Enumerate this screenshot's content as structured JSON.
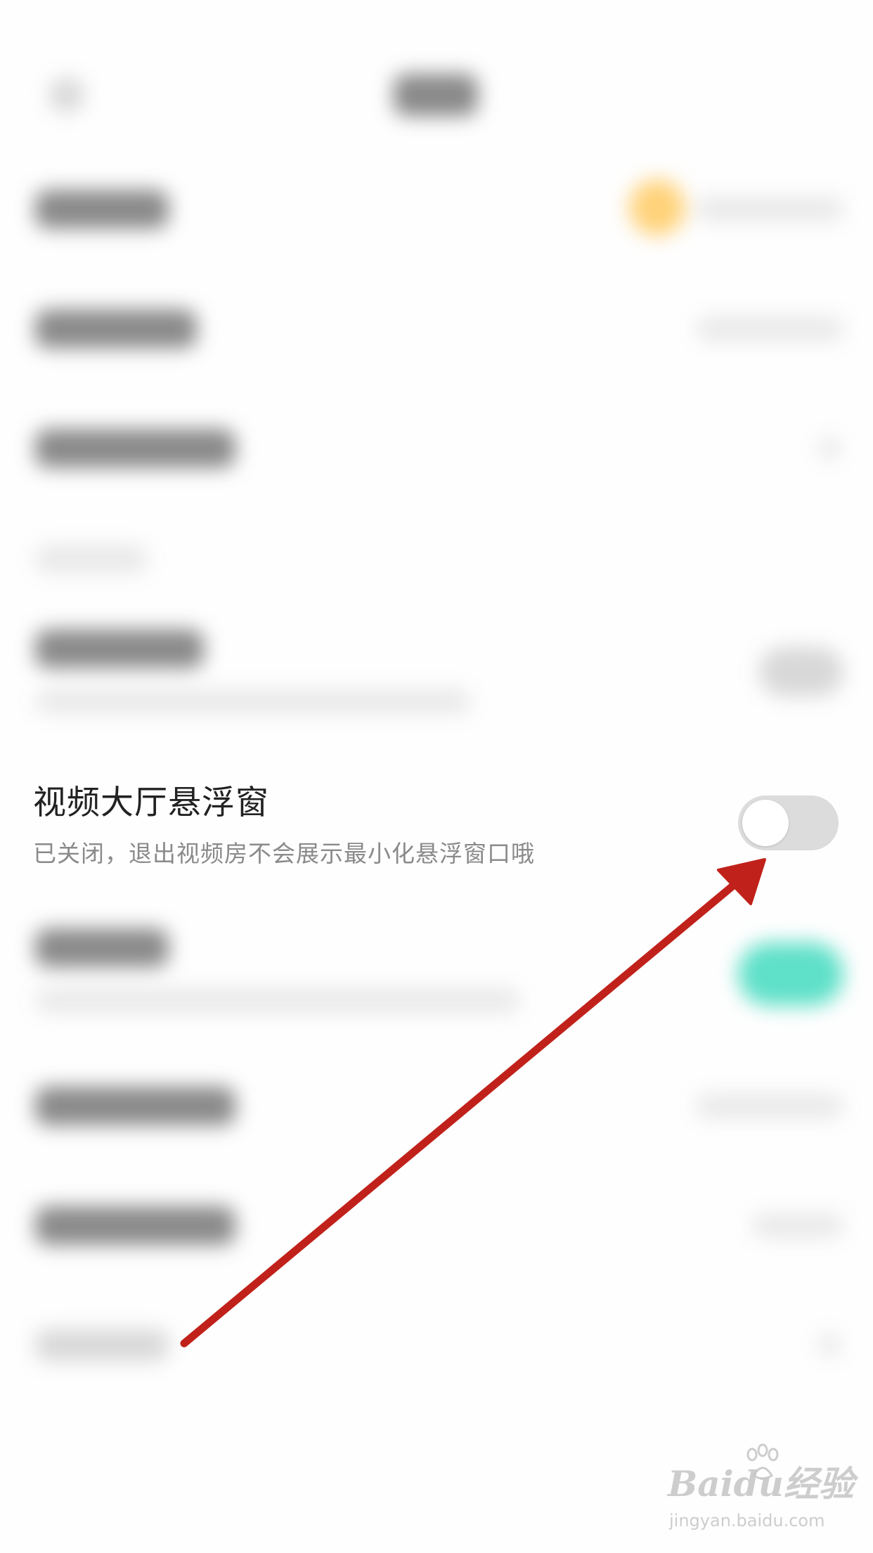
{
  "floating_window_setting": {
    "title": "视频大厅悬浮窗",
    "description": "已关闭，退出视频房不会展示最小化悬浮窗口哦",
    "toggle_state": "off"
  },
  "watermark": {
    "logo": "Baidu经验",
    "url": "jingyan.baidu.com"
  },
  "colors": {
    "arrow": "#c0211a",
    "toggle_off_track": "#dcdcdc",
    "blurred_accent_orange": "#ffd27a",
    "blurred_accent_teal": "#5fe0c8"
  }
}
